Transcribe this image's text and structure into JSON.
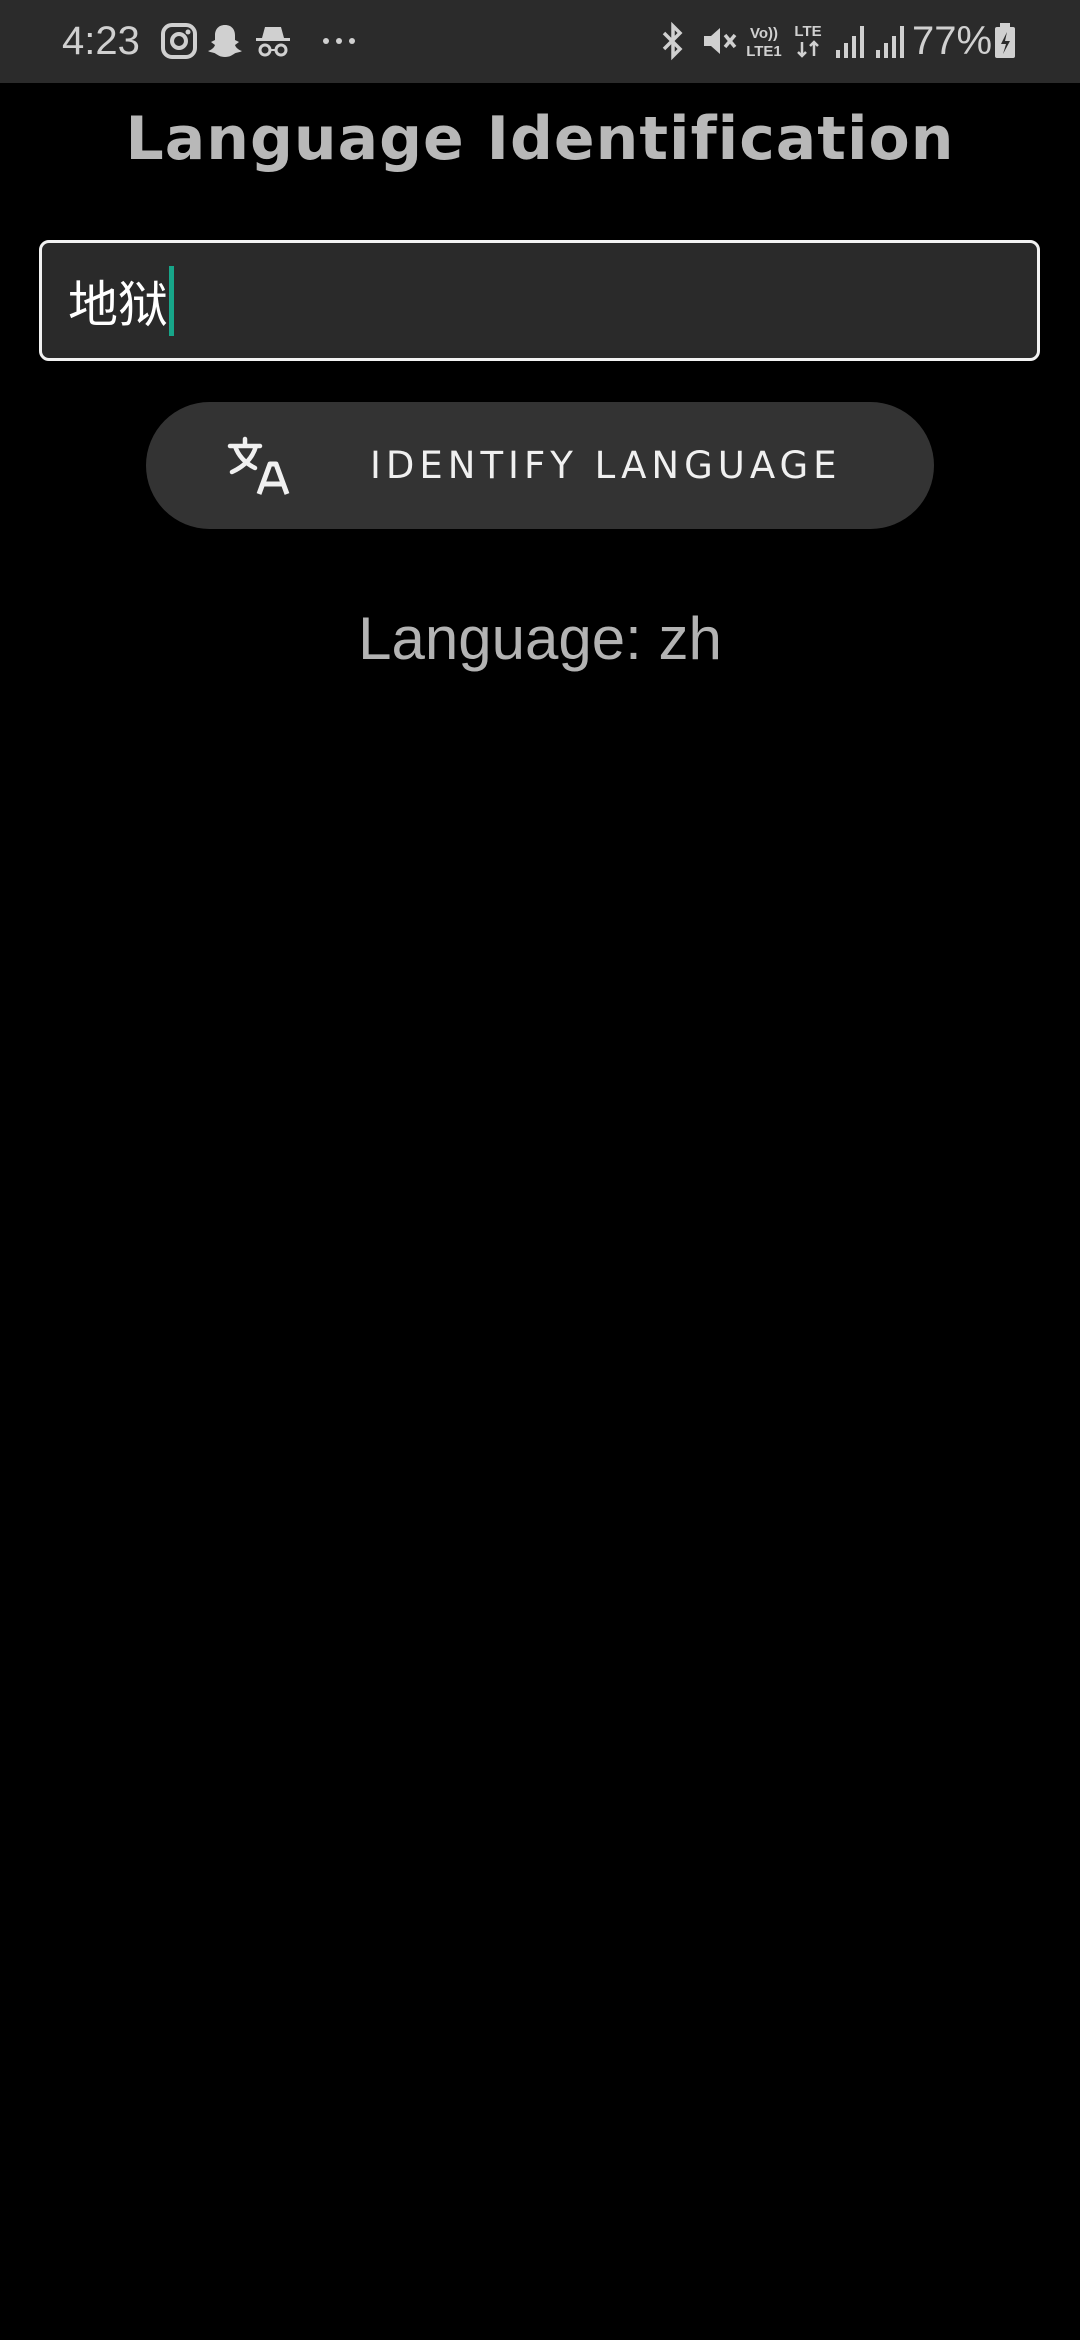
{
  "status_bar": {
    "time": "4:23",
    "battery": "77%",
    "icons": [
      "instagram-icon",
      "snapchat-icon",
      "incognito-icon",
      "more-dots-icon",
      "bluetooth-icon",
      "mute-icon",
      "volte-icon",
      "lte-icon",
      "signal-icon",
      "signal-icon",
      "battery-icon"
    ],
    "volte_label": "Vo)) LTE1",
    "lte_label": "LTE"
  },
  "page": {
    "title": "Language Identification"
  },
  "input": {
    "value": "地狱"
  },
  "button": {
    "label": "IDENTIFY LANGUAGE",
    "icon": "translate-icon"
  },
  "result": {
    "text": "Language: zh"
  },
  "colors": {
    "background": "#000000",
    "status_bar": "#2b2b2b",
    "caret": "#17a589",
    "button": "#333333"
  }
}
